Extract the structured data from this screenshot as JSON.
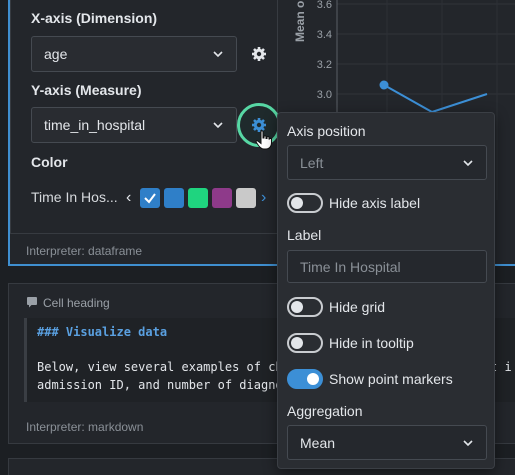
{
  "config": {
    "x_axis_label": "X-axis (Dimension)",
    "x_axis_value": "age",
    "y_axis_label": "Y-axis (Measure)",
    "y_axis_value": "time_in_hospital",
    "color_label": "Color",
    "color_series": "Time In Hos...",
    "swatches": [
      "#2f7fc8",
      "#2f7fc8",
      "#1fd47f",
      "#8e3a8a",
      "#c9c9c9"
    ],
    "interpreter": "Interpreter: dataframe"
  },
  "chart": {
    "ylabel": "Mean o",
    "y_ticks": [
      "3.6",
      "3.4",
      "3.2",
      "3.0"
    ],
    "line_color": "#3c8fd6"
  },
  "chart_data": {
    "type": "line",
    "ylabel": "Mean o",
    "y_ticks": [
      3.6,
      3.4,
      3.2,
      3.0
    ],
    "series": [
      {
        "values": [
          3.06,
          2.88,
          3.0
        ]
      }
    ]
  },
  "markdown_cell": {
    "heading": "Cell heading",
    "line1": "### Visualize data",
    "line2": "Below, view several examples of ch",
    "line2_tail": "t i",
    "line3": "admission ID, and number of diagno",
    "interpreter": "Interpreter: markdown"
  },
  "popover": {
    "axis_position_label": "Axis position",
    "axis_position_value": "Left",
    "hide_axis_label": "Hide axis label",
    "label_label": "Label",
    "label_placeholder": "Time In Hospital",
    "hide_grid": "Hide grid",
    "hide_in_tooltip": "Hide in tooltip",
    "show_point_markers": "Show point markers",
    "aggregation_label": "Aggregation",
    "aggregation_value": "Mean"
  },
  "icons": {
    "gear": "gear-icon",
    "chevron": "chevron-down-icon",
    "hand": "pointer-hand-icon",
    "comment": "comment-icon"
  }
}
